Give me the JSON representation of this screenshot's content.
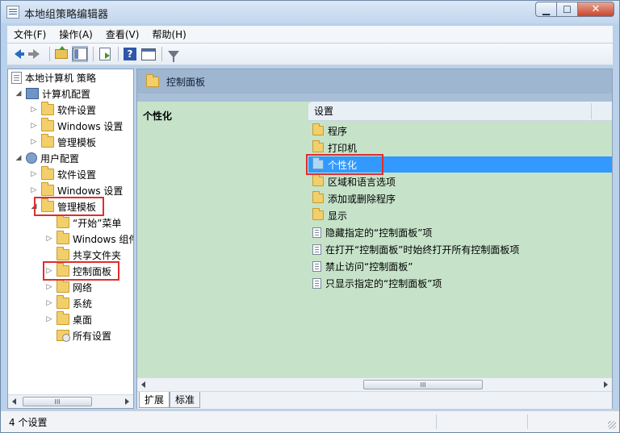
{
  "window": {
    "title": "本地组策略编辑器",
    "minimize": "▁",
    "maximize": "☐",
    "close": "✕"
  },
  "menu": [
    "文件(F)",
    "操作(A)",
    "查看(V)",
    "帮助(H)"
  ],
  "toolbar_icons": [
    "back-icon",
    "forward-icon",
    "up-folder-icon",
    "show-hide-tree-icon",
    "export-icon",
    "help-icon",
    "properties-icon",
    "filter-icon"
  ],
  "tree": {
    "root": "本地计算机 策略",
    "computer_config": "计算机配置",
    "c_software": "软件设置",
    "c_windows": "Windows 设置",
    "c_admin": "管理模板",
    "user_config": "用户配置",
    "u_software": "软件设置",
    "u_windows": "Windows 设置",
    "u_admin": "管理模板",
    "start_menu": "“开始”菜单",
    "windows_components": "Windows 组件",
    "shared_folders": "共享文件夹",
    "control_panel": "控制面板",
    "network": "网络",
    "system": "系统",
    "desktop": "桌面",
    "all_settings": "所有设置"
  },
  "right_pane": {
    "header": "控制面板",
    "category_title": "个性化",
    "column_setting": "设置",
    "items": [
      {
        "type": "folder",
        "label": "程序"
      },
      {
        "type": "folder",
        "label": "打印机"
      },
      {
        "type": "folder",
        "label": "个性化",
        "selected": true
      },
      {
        "type": "folder",
        "label": "区域和语言选项"
      },
      {
        "type": "folder",
        "label": "添加或删除程序"
      },
      {
        "type": "folder",
        "label": "显示"
      },
      {
        "type": "setting",
        "label": "隐藏指定的“控制面板”项"
      },
      {
        "type": "setting",
        "label": "在打开“控制面板”时始终打开所有控制面板项"
      },
      {
        "type": "setting",
        "label": "禁止访问“控制面板”"
      },
      {
        "type": "setting",
        "label": "只显示指定的“控制面板”项"
      }
    ]
  },
  "scroll": {
    "thumb": "III"
  },
  "tabs": {
    "extended": "扩展",
    "standard": "标准"
  },
  "status": {
    "text": "4 个设置"
  },
  "colors": {
    "selection": "#3399ff",
    "highlight_box": "#e02d2d",
    "right_pane_bg": "#c6e3c9"
  }
}
